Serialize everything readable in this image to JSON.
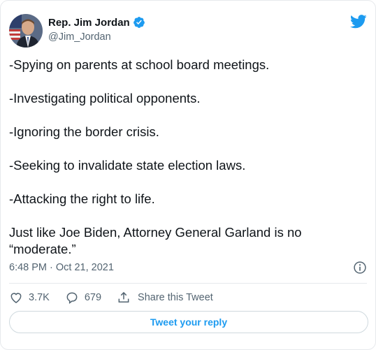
{
  "author": {
    "display_name": "Rep. Jim Jordan",
    "handle": "@Jim_Jordan",
    "verified": true
  },
  "tweet": {
    "lines": [
      "-Spying on parents at school board meetings.",
      "-Investigating political opponents.",
      "-Ignoring the border crisis.",
      "-Seeking to invalidate state election laws.",
      "-Attacking the right to life.",
      "Just like Joe Biden, Attorney General Garland is no “moderate.”"
    ],
    "timestamp": "6:48 PM · Oct 21, 2021"
  },
  "actions": {
    "likes": "3.7K",
    "replies": "679",
    "share_label": "Share this Tweet"
  },
  "reply_button_label": "Tweet your reply",
  "icons": {
    "brand": "twitter-bird-icon",
    "verified": "verified-badge-icon",
    "info": "info-icon",
    "like": "heart-icon",
    "reply": "reply-bubble-icon",
    "share": "share-icon"
  },
  "colors": {
    "accent": "#1d9bf0",
    "text": "#0f1419",
    "secondary": "#536471",
    "border": "#e6e9ec"
  }
}
